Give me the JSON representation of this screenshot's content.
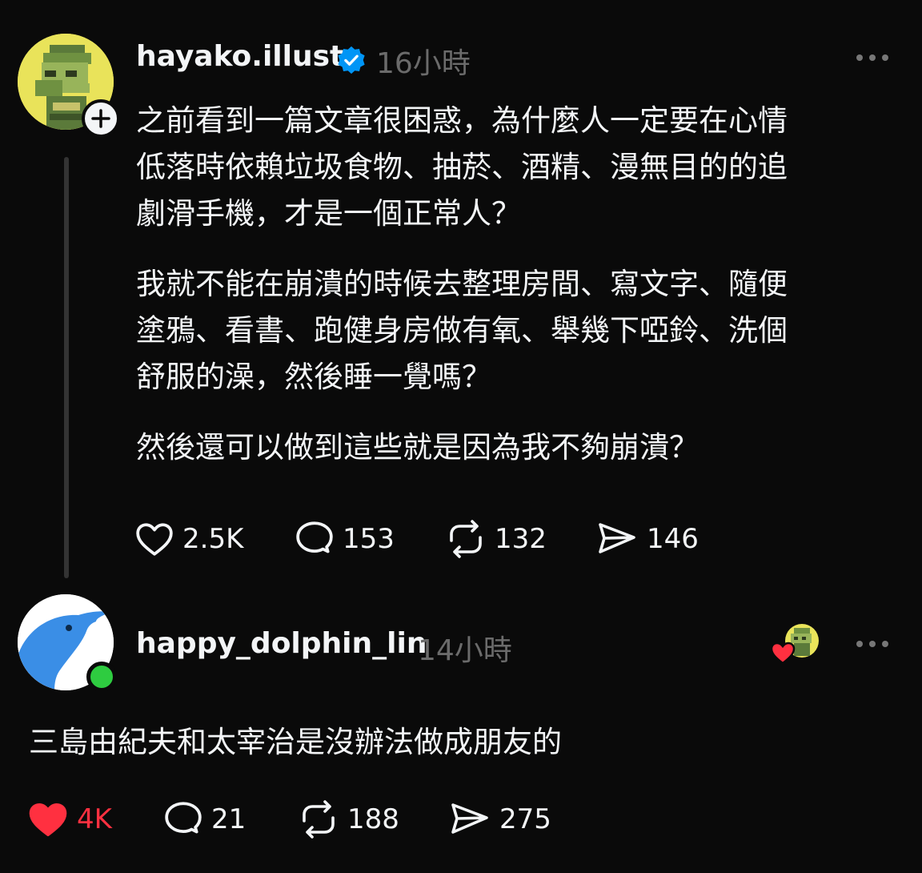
{
  "post": {
    "username": "hayako.illust",
    "time": "16小時",
    "paragraphs": [
      [
        "之前看到一篇文章很困惑，為什麼人一定要在心情",
        "低落時依賴垃圾食物、抽菸、酒精、漫無目的的追",
        "劇滑手機，才是一個正常人？"
      ],
      [
        "我就不能在崩潰的時候去整理房間、寫文字、隨便",
        "塗鴉、看書、跑健身房做有氧、舉幾下啞鈴、洗個",
        "舒服的澡，然後睡一覺嗎？"
      ],
      [
        "然後還可以做到這些就是因為我不夠崩潰？"
      ]
    ],
    "likes": "2.5K",
    "comments": "153",
    "reposts": "132",
    "shares": "146"
  },
  "reply": {
    "username": "happy_dolphin_lin",
    "time": "14小時",
    "text": "三島由紀夫和太宰治是沒辦法做成朋友的",
    "likes": "4K",
    "comments": "21",
    "reposts": "188",
    "shares": "275"
  },
  "colors": {
    "background": "#0a0a0a",
    "text": "#f3f5f7",
    "muted": "#6b6b6b",
    "verified": "#0095f6",
    "liked": "#ff3040",
    "online": "#2ecc40"
  },
  "icons": [
    "verified-badge-icon",
    "more-icon",
    "heart-icon",
    "comment-icon",
    "repost-icon",
    "share-icon",
    "follow-plus-icon",
    "liked-heart-icon"
  ]
}
